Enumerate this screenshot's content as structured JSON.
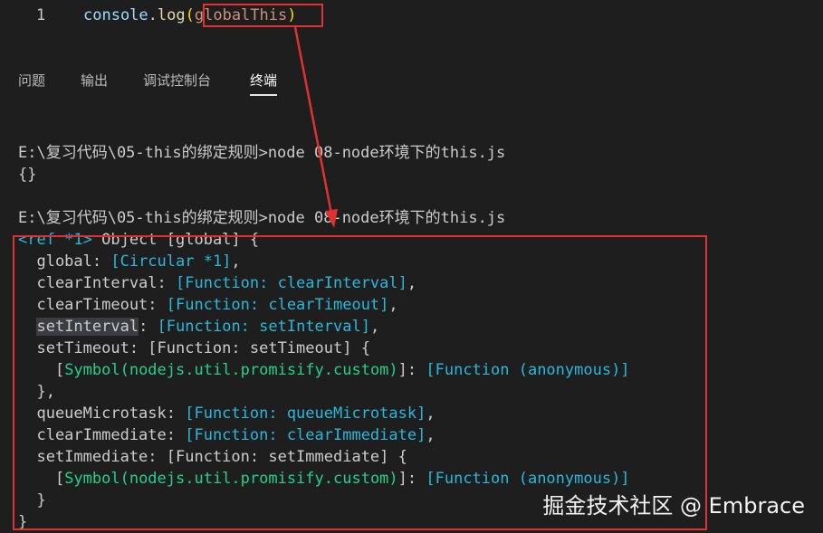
{
  "editor": {
    "line_number": "1",
    "code": {
      "object": "console",
      "dot": ".",
      "method": "log",
      "open_paren": "(",
      "argument": "globalThis",
      "close_paren": ")"
    }
  },
  "panel": {
    "tabs": [
      {
        "label": "问题"
      },
      {
        "label": "输出"
      },
      {
        "label": "调试控制台"
      },
      {
        "label": "终端",
        "active": true
      }
    ]
  },
  "terminal": {
    "lines": [
      "",
      "E:\\复习代码\\05-this的绑定规则>node 08-node环境下的this.js",
      "{}",
      "",
      "E:\\复习代码\\05-this的绑定规则>node 08-node环境下的this.js"
    ],
    "output": {
      "ref_line": {
        "ref": "<ref *1>",
        "rest": " Object [global] {"
      },
      "global_line": {
        "key": "  global: ",
        "value": "[Circular *1]",
        "tail": ","
      },
      "clearInterval_line": {
        "key": "  clearInterval: ",
        "value": "[Function: clearInterval]",
        "tail": ","
      },
      "clearTimeout_line": {
        "key": "  clearTimeout: ",
        "value": "[Function: clearTimeout]",
        "tail": ","
      },
      "setInterval_line": {
        "key": "setInterval",
        "colon": ": ",
        "value": "[Function: setInterval]",
        "tail": ","
      },
      "setTimeout_line": {
        "text": "  setTimeout: [Function: setTimeout] {"
      },
      "setTimeout_symbol": {
        "open": "    [",
        "symbol": "Symbol(nodejs.util.promisify.custom)",
        "mid": "]: ",
        "value": "[Function (anonymous)]"
      },
      "close_brace_comma": "  },",
      "queueMicrotask_line": {
        "key": "  queueMicrotask: ",
        "value": "[Function: queueMicrotask]",
        "tail": ","
      },
      "clearImmediate_line": {
        "key": "  clearImmediate: ",
        "value": "[Function: clearImmediate]",
        "tail": ","
      },
      "setImmediate_line": {
        "text": "  setImmediate: [Function: setImmediate] {"
      },
      "setImmediate_symbol": {
        "open": "    [",
        "symbol": "Symbol(nodejs.util.promisify.custom)",
        "mid": "]: ",
        "value": "[Function (anonymous)]"
      },
      "close_brace_inner": "  }",
      "close_brace_outer": "}"
    }
  },
  "watermark": "掘金技术社区 @ Embrace",
  "colors": {
    "background": "#1e1e1e",
    "annotation_red": "#e03131",
    "terminal_cyan": "#29b8db",
    "terminal_green": "#23d18b"
  }
}
